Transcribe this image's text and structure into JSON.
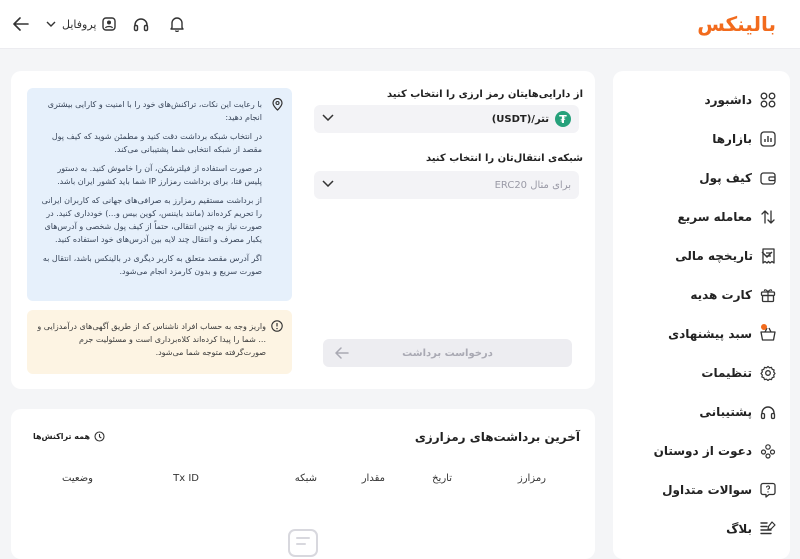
{
  "header": {
    "brand": "بالینکس",
    "profile_label": "پروفایل"
  },
  "sidebar": {
    "items": [
      {
        "label": "داشبورد",
        "icon": "grid-icon"
      },
      {
        "label": "بازارها",
        "icon": "chart-icon"
      },
      {
        "label": "کیف پول",
        "icon": "wallet-icon"
      },
      {
        "label": "معامله سریع",
        "icon": "swap-arrows-icon"
      },
      {
        "label": "تاریخچه مالی",
        "icon": "receipt-icon"
      },
      {
        "label": "کارت هدیه",
        "icon": "gift-icon"
      },
      {
        "label": "سبد پیشنهادی",
        "icon": "basket-icon"
      },
      {
        "label": "تنظیمات",
        "icon": "gear-icon"
      },
      {
        "label": "پشتیبانی",
        "icon": "headset-icon"
      },
      {
        "label": "دعوت از دوستان",
        "icon": "users-icon"
      },
      {
        "label": "سوالات متداول",
        "icon": "question-icon"
      },
      {
        "label": "بلاگ",
        "icon": "blog-icon"
      }
    ]
  },
  "withdraw": {
    "asset_label": "از دارایی‌هایتان رمز ارزی را انتخاب کنید",
    "asset_value": "تتر/(USDT)",
    "network_label": "شبکه‌ی انتقال‌تان را انتخاب کنید",
    "network_placeholder": "برای مثال ERC20",
    "submit_label": "درخواست برداشت"
  },
  "info": {
    "p1": "با رعایت این نکات، تراکنش‌های خود را با امنیت و کارایی بیشتری انجام دهید:",
    "p2": "در انتخاب شبکه برداشت دقت کنید و مطمئن شوید که کیف پول مقصد از شبکه انتخابی شما پشتیبانی می‌کند.",
    "p3": "در صورت استفاده از فیلترشکن، آن را خاموش کنید. به دستور پلیس فتا، برای برداشت رمزارز IP شما باید کشور ایران باشد.",
    "p4": "از برداشت مستقیم رمزارز به صرافی‌های جهانی که کاربران ایرانی را تحریم کرده‌اند (مانند بایننس، کوین بیس و...) خودداری کنید. در صورت نیاز به چنین انتقالی، حتماً از کیف پول شخصی و آدرس‌های یکبار مصرف و انتقال چند لایه بین آدرس‌های خود استفاده کنید.",
    "p5": "اگر آدرس مقصد متعلق به کاربر دیگری در بالینکس باشد، انتقال به صورت سریع و بدون کارمزد انجام می‌شود."
  },
  "warning": {
    "text": "واریز وجه به حساب افراد ناشناس که از طریق آگهی‌های درآمدزایی و ... شما را پیدا کرده‌اند کلاه‌برداری است و مسئولیت جرم صورت‌گرفته متوجه شما می‌شود."
  },
  "history": {
    "title": "آخرین برداشت‌های رمزارزی",
    "all_link": "همه تراکنش‌ها",
    "columns": [
      "رمزارز",
      "تاریخ",
      "مقدار",
      "شبکه",
      "Tx ID",
      "وضعیت"
    ]
  },
  "colors": {
    "brand": "#f26b1d",
    "tether": "#26a17b",
    "info_bg": "#e6f0fb",
    "warn_bg": "#fdf4e3"
  }
}
